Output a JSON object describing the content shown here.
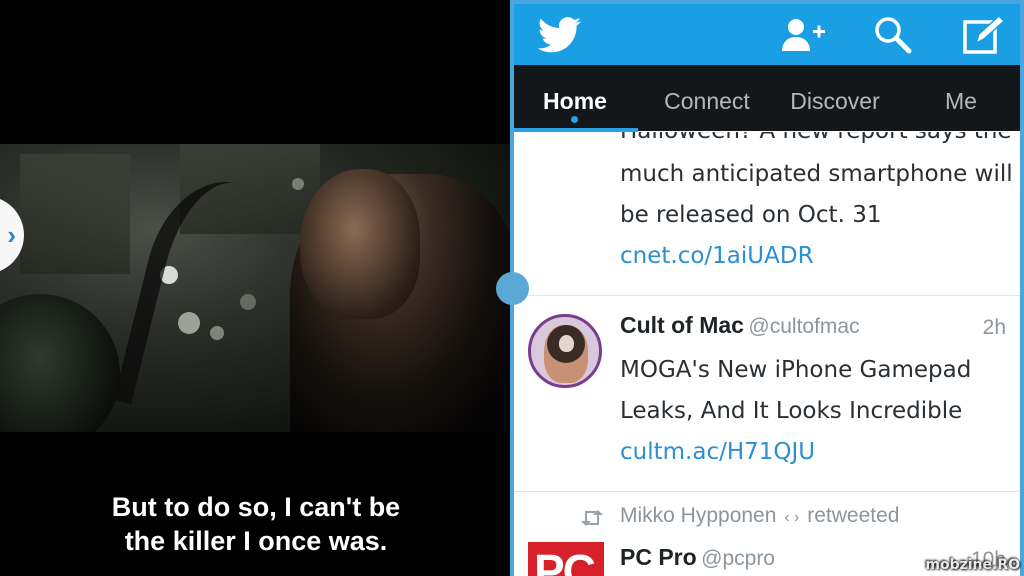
{
  "video": {
    "subtitle_lines": [
      "But to do so, I can't be",
      "the killer I once was."
    ],
    "handle_glyph": "›"
  },
  "twitter": {
    "colors": {
      "topbar": "#1a9ee4",
      "tabbar": "#14171a",
      "accent": "#2aa0e6",
      "link": "#2b8fd0"
    },
    "topbar_icons": [
      "twitter-bird-icon",
      "add-user-icon",
      "search-icon",
      "compose-icon"
    ],
    "tabs": [
      {
        "label": "Home",
        "active": true
      },
      {
        "label": "Connect",
        "active": false
      },
      {
        "label": "Discover",
        "active": false
      },
      {
        "label": "Me",
        "active": false
      }
    ],
    "tweets": [
      {
        "partial_line": "Halloween? A new report says the",
        "lines": [
          "much anticipated smartphone will",
          "be released on Oct. 31"
        ],
        "link": "cnet.co/1aiUADR"
      },
      {
        "name": "Cult of Mac",
        "handle": "@cultofmac",
        "time": "2h",
        "lines": [
          "MOGA's New iPhone Gamepad",
          "Leaks, And It Looks Incredible"
        ],
        "link": "cultm.ac/H71QJU"
      },
      {
        "retweeted_by": "Mikko Hypponen",
        "retweet_marker": "‹ ›",
        "retweet_label": "retweeted",
        "name": "PC Pro",
        "handle": "@pcpro",
        "time": "10h",
        "avatar_text": "PC"
      }
    ]
  },
  "watermark": "mobzine.RO"
}
